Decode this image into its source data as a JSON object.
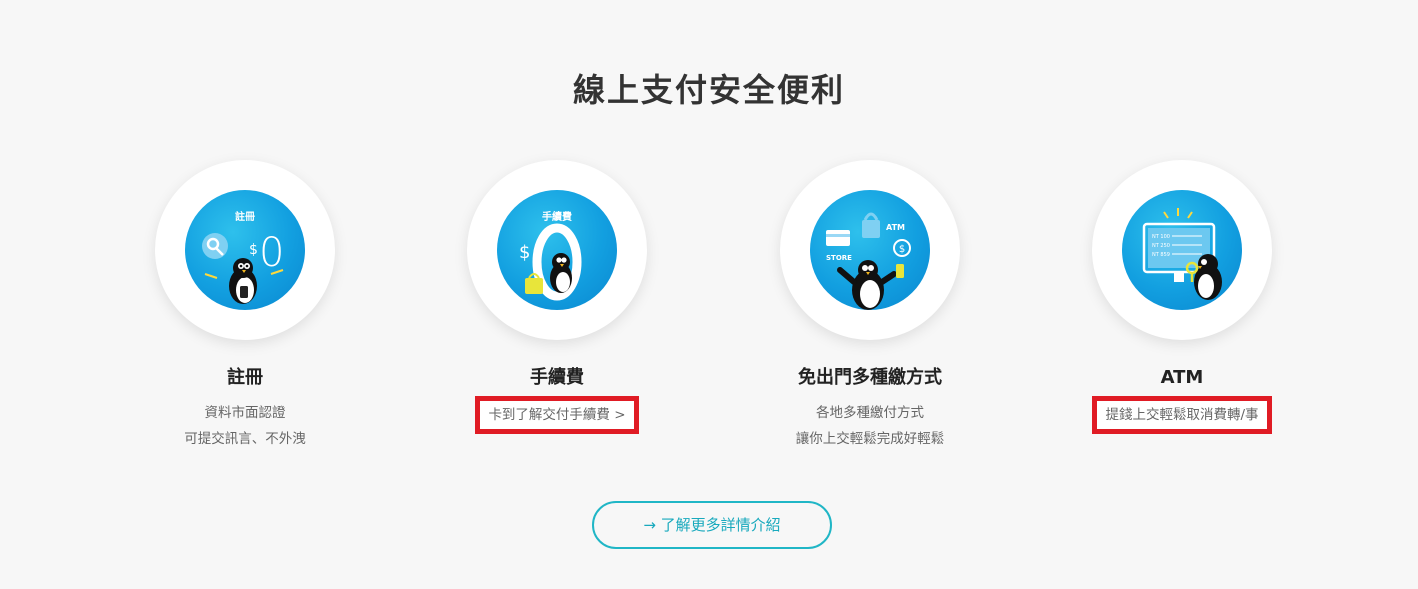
{
  "section": {
    "title": "線上支付安全便利"
  },
  "features": [
    {
      "title": "註冊",
      "icon": "penguin-register-icon",
      "badge": "註冊",
      "amount": "$0",
      "desc": [
        "資料市面認證",
        "可提交訊言、不外洩"
      ]
    },
    {
      "title": "手續費",
      "icon": "penguin-fee-icon",
      "badge": "手續費",
      "amount": "$0",
      "desc": [
        "卡到了解交付手續費 >"
      ]
    },
    {
      "title": "免出門多種繳方式",
      "icon": "penguin-payment-methods-icon",
      "badge_store": "STORE",
      "badge_atm": "ATM",
      "desc": [
        "各地多種繳付方式",
        "讓你上交輕鬆完成好輕鬆"
      ]
    },
    {
      "title": "ATM",
      "icon": "penguin-atm-icon",
      "screen_lines": [
        "NT 100",
        "NT 250",
        "NT 859"
      ],
      "desc": [
        "提錢上交輕鬆取消費轉/事"
      ]
    }
  ],
  "more_button": {
    "label": "→ 了解更多詳情介紹"
  },
  "colors": {
    "accent": "#20b6c6",
    "circle_blue": "#129fe0",
    "highlight_red": "#e01b24",
    "background": "#f7f7f7"
  }
}
